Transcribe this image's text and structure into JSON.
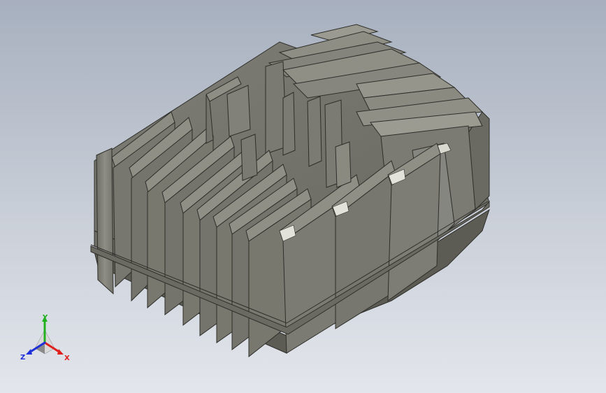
{
  "viewport": {
    "background_top": "#a7b0bf",
    "background_bottom": "#e3e6ec"
  },
  "model": {
    "part": "finned-cylinder-head",
    "surface_color": "#8b8b82",
    "shadow_color": "#5f5f57",
    "highlight_color": "#b9b9ae",
    "edge_color": "#2e2e2a"
  },
  "triad": {
    "x_label": "X",
    "y_label": "Y",
    "z_label": "Z",
    "x_color": "#e0201c",
    "y_color": "#22b020",
    "z_color": "#2030d8"
  }
}
